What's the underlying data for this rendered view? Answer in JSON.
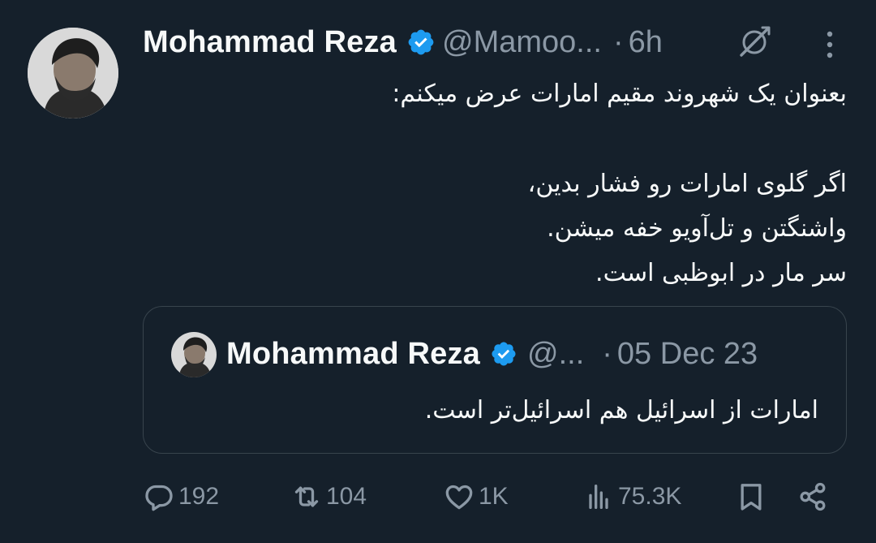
{
  "tweet": {
    "author": {
      "display_name": "Mohammad Reza",
      "handle": "@Mamoo...",
      "verified": true
    },
    "separator": "·",
    "time": "6h",
    "body_lines": [
      "بعنوان یک شهروند مقیم امارات عرض میکنم:",
      "",
      "اگر گلوی امارات رو فشار بدین،",
      "واشنگتن و تل‌آویو خفه میشن.",
      "سر مار در ابوظبی است."
    ]
  },
  "quoted_tweet": {
    "author": {
      "display_name": "Mohammad Reza",
      "handle": "@...",
      "verified": true
    },
    "separator": "·",
    "date": "05 Dec 23",
    "text": "امارات از اسرائیل هم اسرائیل‌تر است."
  },
  "actions": {
    "replies": "192",
    "reposts": "104",
    "likes": "1K",
    "views": "75.3K"
  },
  "icons": {
    "verified": "verified-badge-icon",
    "grok": "grok-icon",
    "more": "more-icon",
    "reply": "reply-icon",
    "repost": "repost-icon",
    "like": "heart-icon",
    "views": "views-icon",
    "bookmark": "bookmark-icon",
    "share": "share-icon"
  },
  "colors": {
    "background": "#15202b",
    "text": "#f7f9f9",
    "muted": "#8b98a5",
    "verified_blue": "#1d9bf0",
    "border": "#38444d"
  }
}
